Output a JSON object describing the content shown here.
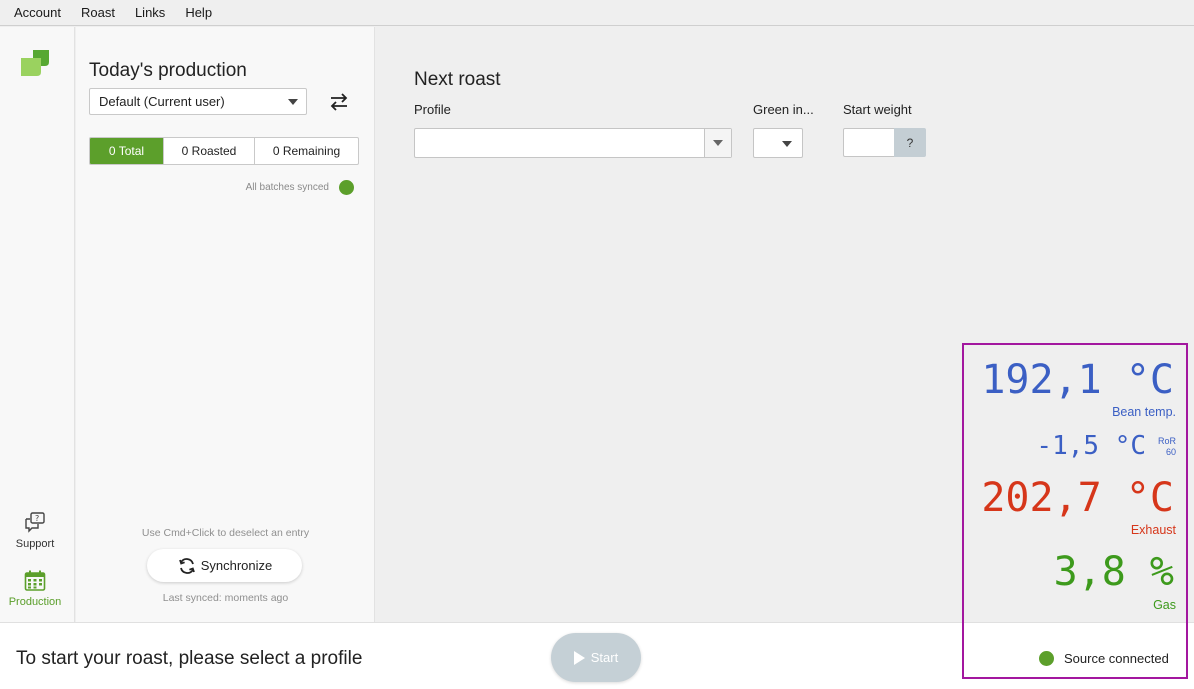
{
  "menu": {
    "items": [
      "Account",
      "Roast",
      "Links",
      "Help"
    ]
  },
  "nav": {
    "support_label": "Support",
    "production_label": "Production"
  },
  "production": {
    "title": "Today's production",
    "user_select": "Default (Current user)",
    "segments": [
      "0 Total",
      "0 Roasted",
      "0 Remaining"
    ],
    "active_segment": 0,
    "sync_status": "All batches synced",
    "hint": "Use Cmd+Click to deselect an entry",
    "sync_button": "Synchronize",
    "last_synced": "Last synced: moments ago"
  },
  "next_roast": {
    "title": "Next roast",
    "profile_label": "Profile",
    "profile_value": "",
    "green_label": "Green in...",
    "green_value": "",
    "weight_label": "Start weight",
    "weight_value": "",
    "weight_help": "?"
  },
  "readouts": {
    "bean_temp": {
      "value": "192,1 °C",
      "label": "Bean temp."
    },
    "ror": {
      "value": "-1,5 °C",
      "sub_top": "RoR",
      "sub_bottom": "60"
    },
    "exhaust": {
      "value": "202,7 °C",
      "label": "Exhaust"
    },
    "gas": {
      "value": "3,8 %",
      "label": "Gas"
    }
  },
  "bottom": {
    "message": "To start your roast, please select a profile",
    "start_button": "Start",
    "source_status": "Source connected"
  },
  "colors": {
    "accent_green": "#5c9f2b",
    "bean_blue": "#3b5fc4",
    "exhaust_red": "#d6361a",
    "gas_green": "#3d9a1c",
    "highlight_border": "#a3179f"
  }
}
